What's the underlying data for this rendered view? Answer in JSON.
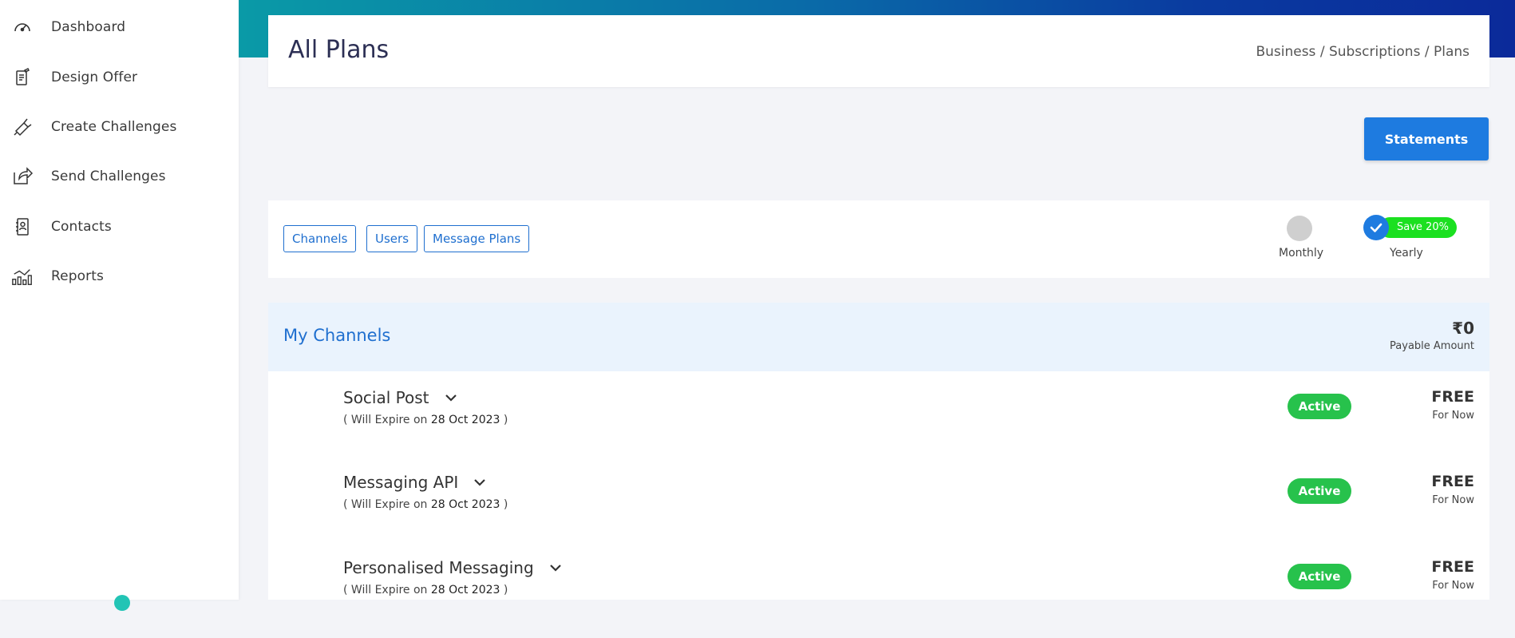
{
  "sidebar": {
    "items": [
      {
        "label": "Dashboard",
        "icon": "speedometer-icon"
      },
      {
        "label": "Design Offer",
        "icon": "design-offer-icon"
      },
      {
        "label": "Create Challenges",
        "icon": "megaphone-icon"
      },
      {
        "label": "Send Challenges",
        "icon": "share-icon"
      },
      {
        "label": "Contacts",
        "icon": "contact-book-icon"
      },
      {
        "label": "Reports",
        "icon": "bar-chart-icon"
      }
    ]
  },
  "header": {
    "title": "All Plans",
    "breadcrumb": "Business / Subscriptions / Plans"
  },
  "actions": {
    "statements_label": "Statements"
  },
  "filters": {
    "tabs": [
      "Channels",
      "Users",
      "Message Plans"
    ],
    "billing": {
      "monthly_label": "Monthly",
      "yearly_label": "Yearly",
      "yearly_badge": "Save 20%",
      "selected": "Yearly"
    }
  },
  "channels": {
    "title": "My Channels",
    "payable_amount": "₹0",
    "payable_label": "Payable Amount",
    "rows": [
      {
        "name": "Social Post",
        "expiry_prefix": "( Will Expire on",
        "expiry_date": "28 Oct 2023",
        "expiry_suffix": ")",
        "status": "Active",
        "price": "FREE",
        "price_note": "For Now"
      },
      {
        "name": "Messaging API",
        "expiry_prefix": "( Will Expire on",
        "expiry_date": "28 Oct 2023",
        "expiry_suffix": ")",
        "status": "Active",
        "price": "FREE",
        "price_note": "For Now"
      },
      {
        "name": "Personalised Messaging",
        "expiry_prefix": "( Will Expire on",
        "expiry_date": "28 Oct 2023",
        "expiry_suffix": ")",
        "status": "Active",
        "price": "FREE",
        "price_note": "For Now"
      }
    ]
  },
  "colors": {
    "primary": "#1e7be0",
    "link": "#1f6fcf",
    "active": "#27c24c",
    "save": "#1be020",
    "header_bg": "#eaf3fd"
  }
}
